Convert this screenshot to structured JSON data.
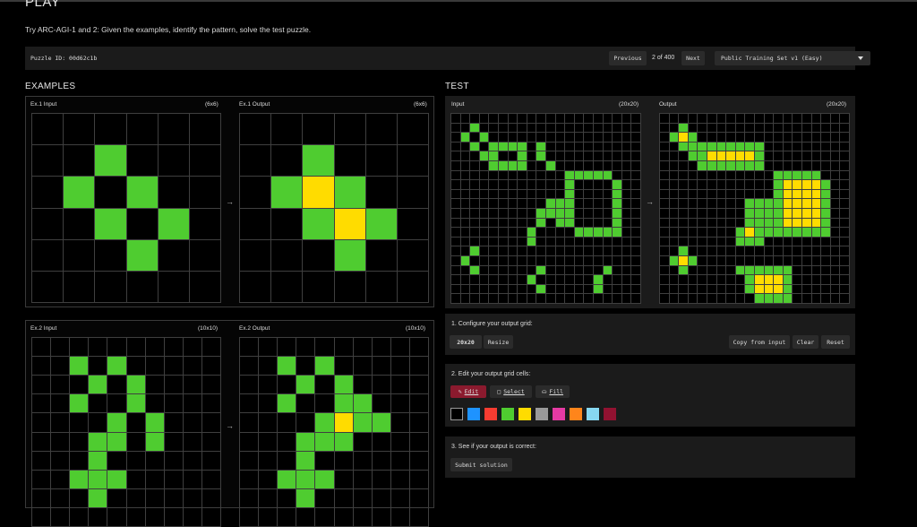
{
  "page": {
    "title": "PLAY",
    "subtitle": "Try ARC-AGI-1 and 2: Given the examples, identify the pattern, solve the test puzzle."
  },
  "topbar": {
    "puzzle_id": "Puzzle ID: 00d62c1b",
    "previous": "Previous",
    "position": "2 of 400",
    "next": "Next",
    "set": "Public Training Set v1 (Easy)"
  },
  "examples": {
    "heading": "EXAMPLES",
    "ex1": {
      "input_label": "Ex.1 Input",
      "input_size": "(6x6)",
      "output_label": "Ex.1 Output",
      "output_size": "(6x6)",
      "input_grid": [
        "000000",
        "003000",
        "030300",
        "003030",
        "000300",
        "000000"
      ],
      "output_grid": [
        "000000",
        "003000",
        "034300",
        "003430",
        "000300",
        "000000"
      ]
    },
    "ex2": {
      "input_label": "Ex.2 Input",
      "input_size": "(10x10)",
      "output_label": "Ex.2 Output",
      "output_size": "(10x10)",
      "input_grid": [
        "0000000000",
        "0030300000",
        "0003030000",
        "0030030000",
        "0000303000",
        "0003303000",
        "0003000000",
        "0033300000",
        "0003000000",
        "0000000000"
      ],
      "output_grid": [
        "0000000000",
        "0030300000",
        "0003030000",
        "0030033000",
        "0000343300",
        "0003330000",
        "0003000000",
        "0033300000",
        "0003000000",
        "0000000000"
      ]
    }
  },
  "test": {
    "heading": "TEST",
    "input_label": "Input",
    "input_size": "(20x20)",
    "output_label": "Output",
    "output_size": "(20x20)",
    "input_grid": [
      "00000000000000000000",
      "00300000000000000000",
      "03030000000000000000",
      "00303333030000000000",
      "00033003030000000000",
      "00003333003000000000",
      "00000000000033333000",
      "00000000000030000300",
      "00000000000030000300",
      "00000000003330000300",
      "00000000033330000300",
      "00000000030330000300",
      "00000000300003333300",
      "00000000300000000000",
      "00300000000000000000",
      "03000000000000000000",
      "00300000030000003000",
      "00000000300000030000",
      "00000000030000030000",
      "00000000000000000000"
    ],
    "output_grid": [
      "00000000000000000000",
      "00300000000000000000",
      "03430000000000000000",
      "00333333333000000000",
      "00033444443000000000",
      "00003333333000000000",
      "00000000000033333000",
      "00000000000034444300",
      "00000000000034444300",
      "00000000033334444300",
      "00000000033334444300",
      "00000000033334444300",
      "00000000343333333300",
      "00000000333000000000",
      "00300000000000000000",
      "03430000000000000000",
      "00300000333333000000",
      "00000000034443000000",
      "00000000034443000000",
      "00000000003333000000"
    ]
  },
  "controls": {
    "step1": "1. Configure your output grid:",
    "grid_size_value": "20x20",
    "resize": "Resize",
    "copy_from_input": "Copy from input",
    "clear": "Clear",
    "reset": "Reset",
    "step2": "2. Edit your output grid cells:",
    "edit": "Edit",
    "select": "Select",
    "fill": "Fill",
    "palette": [
      "#000000",
      "#1E93FF",
      "#F93C31",
      "#4FCC30",
      "#FFDC00",
      "#999999",
      "#E53AA3",
      "#FF851B",
      "#87D8F1",
      "#921231"
    ],
    "step3": "3. See if your output is correct:",
    "submit": "Submit solution"
  },
  "colors": {
    "green": "#4FCC30",
    "yellow": "#FFDC00",
    "accent_edit": "#8B1A2E"
  }
}
